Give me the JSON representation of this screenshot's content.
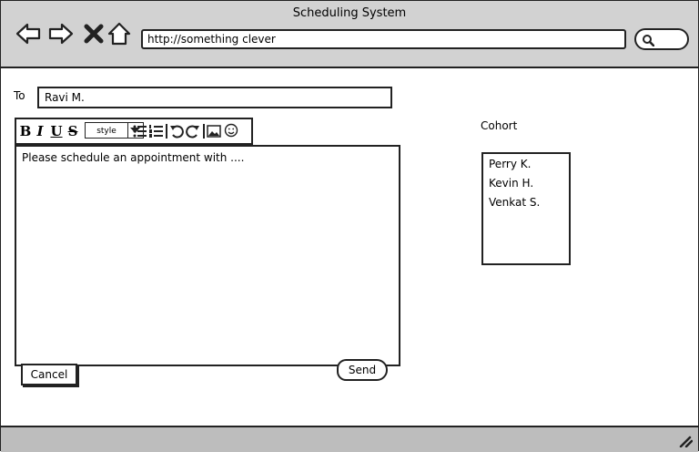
{
  "window": {
    "title": "Scheduling System"
  },
  "browser": {
    "url": "http://something clever",
    "nav_icons": [
      "back-icon",
      "forward-icon",
      "close-icon",
      "home-icon"
    ],
    "search_icon": "search-icon"
  },
  "compose": {
    "to_label": "To",
    "to_value": "Ravi M.",
    "toolbar": {
      "bold": "B",
      "italic": "I",
      "underline": "U",
      "strike": "S",
      "style_select": "style"
    },
    "body_text": "Please schedule an appointment with ....",
    "cancel_label": "Cancel",
    "send_label": "Send"
  },
  "cohort": {
    "title": "Cohort",
    "members": [
      "Perry K.",
      "Kevin H.",
      "Venkat S."
    ]
  }
}
